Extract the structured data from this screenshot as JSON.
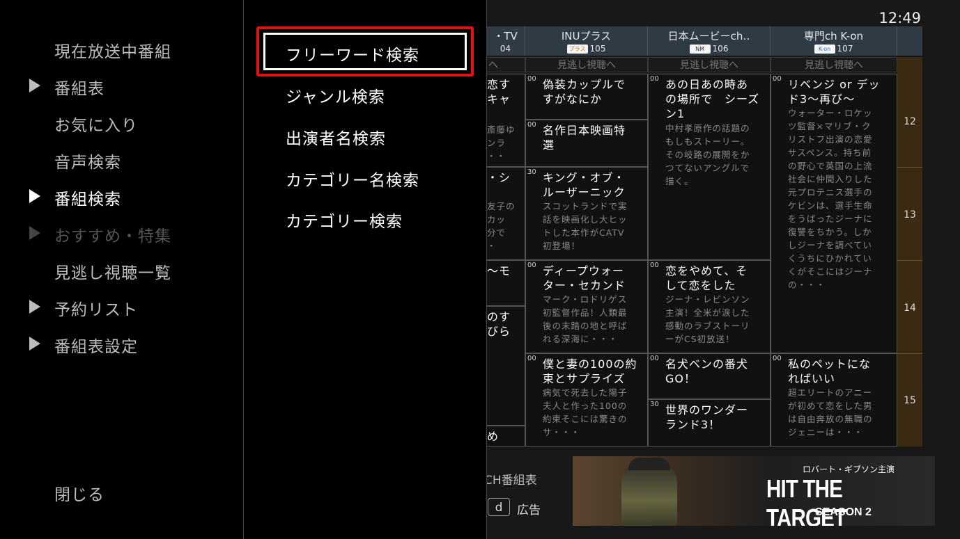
{
  "clock": "12:49",
  "left_menu": {
    "items": [
      {
        "label": "現在放送中番組",
        "arrow": false,
        "state": "normal"
      },
      {
        "label": "番組表",
        "arrow": true,
        "state": "normal"
      },
      {
        "label": "お気に入り",
        "arrow": false,
        "state": "normal"
      },
      {
        "label": "音声検索",
        "arrow": false,
        "state": "normal"
      },
      {
        "label": "番組検索",
        "arrow": true,
        "state": "active"
      },
      {
        "label": "おすすめ・特集",
        "arrow": true,
        "state": "disabled"
      },
      {
        "label": "見逃し視聴一覧",
        "arrow": false,
        "state": "normal"
      },
      {
        "label": "予約リスト",
        "arrow": true,
        "state": "normal"
      },
      {
        "label": "番組表設定",
        "arrow": true,
        "state": "normal"
      }
    ],
    "close_label": "閉じる"
  },
  "sub_menu": {
    "selected_index": 0,
    "items": [
      "フリーワード検索",
      "ジャンル検索",
      "出演者名検索",
      "カテゴリー名検索",
      "カテゴリー検索"
    ]
  },
  "epg": {
    "channels": [
      {
        "name": "・TV",
        "num": "04",
        "logo": ""
      },
      {
        "name": "INUプラス",
        "num": "105",
        "logo": "プラス"
      },
      {
        "name": "日本ムービーch‥",
        "num": "106",
        "logo": "NM"
      },
      {
        "name": "専門ch K-on",
        "num": "107",
        "logo": "K-on"
      }
    ],
    "catchup_label": "見逃し視聴へ",
    "catchup_label_partial": "へ",
    "hours": [
      "12",
      "13",
      "14",
      "15"
    ],
    "partial_column": [
      {
        "title": "恋す\nキャ",
        "desc": "斎藤ゆ\nンラ\n・・"
      },
      {
        "title": "・シ",
        "desc": "友子の\nカッ\n分で\n・"
      },
      {
        "title": "〜モ",
        "desc": ""
      },
      {
        "title": "のす\nびら",
        "desc": ""
      },
      {
        "title": "め",
        "desc": ""
      }
    ],
    "programs": {
      "ch105": [
        {
          "min": "00",
          "title": "偽装カップルで\nすがなにか",
          "desc": ""
        },
        {
          "min": "00",
          "title": "名作日本映画特\n選",
          "desc": ""
        },
        {
          "min": "30",
          "title": "キング・オブ・\nルーザーニック",
          "desc": "スコットランドで実\n話を映画化し大ヒッ\nトした本作がCATV\n初登場！"
        },
        {
          "min": "00",
          "title": "ディープウォー\nター・セカンド",
          "desc": "マーク・ロドリゲス\n初監督作品！人類最\n後の末踏の地と呼ば\nれる深海に・・・"
        },
        {
          "min": "00",
          "title": "僕と妻の100の約\n束とサプライズ",
          "desc": "病気で死去した陽子\n夫人と作った100の\n約束そこには驚きの\nサ・・・"
        }
      ],
      "ch106": [
        {
          "min": "00",
          "title": "あの日あの時あ\nの場所で　シーズ\nン1",
          "desc": "中村孝原作の話題の\nもしもストーリー。\nその岐路の展開をか\nつてないアングルで\n描く。"
        },
        {
          "min": "00",
          "title": "恋をやめて、そ\nして恋をした",
          "desc": "ジーナ・レビンソン\n主演！全米が涙した\n感動のラブストーリ\nーがCS初放送！"
        },
        {
          "min": "00",
          "title": "名犬ベンの番犬\nGO！",
          "desc": ""
        },
        {
          "min": "30",
          "title": "世界のワンダー\nランド3！",
          "desc": ""
        }
      ],
      "ch107": [
        {
          "min": "00",
          "title": "リベンジ or デッ\nド3〜再び〜",
          "desc": "ウォーター・ロケッ\nツ監督×マリブ・ク\nリストフ出演の恋愛\nサスペンス。持ち前\nの野心で英国の上流\n社会に仲間入りした\n元プロテニス選手の\nケビンは、選手生命\nをうばったジーナに\n復讐をちかう。しか\nしジーナを調べてい\nくうちにひかれてい\nくがそこにはジーナ\nの・・・"
        },
        {
          "min": "00",
          "title": "私のペットにな\nればいい",
          "desc": "超エリートのアニー\nが初めて恋をした男\nは自由奔放の無職の\nジェニーは・・・"
        }
      ]
    },
    "bottom_label": "CH番組表",
    "d_button": "d",
    "ad_label": "広告",
    "ad": {
      "tagline": "ロバート・ギブソン主演",
      "title": "HIT THE TARGET",
      "season": "SEASON 2"
    }
  }
}
